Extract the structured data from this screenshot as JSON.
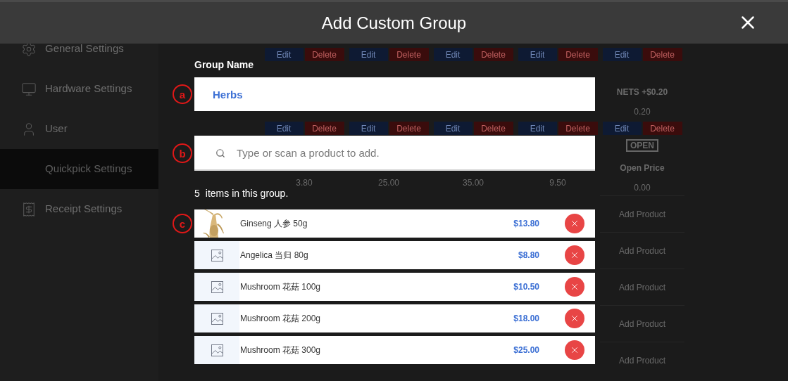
{
  "header": {
    "title": "Add Custom Group"
  },
  "sidebar": {
    "items": [
      {
        "label": "General Settings",
        "selected": false
      },
      {
        "label": "Hardware Settings",
        "selected": false
      },
      {
        "label": "User",
        "selected": false
      },
      {
        "label": "Quickpick Settings",
        "selected": true
      },
      {
        "label": "Receipt Settings",
        "selected": false
      }
    ]
  },
  "tile_rows": [
    {
      "buttons": [
        {
          "edit": "Edit",
          "delete": "Delete"
        },
        {
          "edit": "Edit",
          "delete": "Delete"
        },
        {
          "edit": "Edit",
          "delete": "Delete"
        },
        {
          "edit": "Edit",
          "delete": "Delete"
        },
        {
          "edit": "Edit",
          "delete": "Delete"
        }
      ],
      "side_caption": "NETS +$0.20",
      "side_price": "0.20"
    },
    {
      "buttons": [
        {
          "edit": "Edit",
          "delete": "Delete"
        },
        {
          "edit": "Edit",
          "delete": "Delete"
        },
        {
          "edit": "Edit",
          "delete": "Delete"
        },
        {
          "edit": "Edit",
          "delete": "Delete"
        },
        {
          "edit": "Edit",
          "delete": "Delete"
        }
      ],
      "prices": [
        "3.80",
        "25.00",
        "35.00",
        "9.50"
      ],
      "side_logo": "OPEN",
      "side_caption": "Open Price",
      "side_price": "0.00"
    }
  ],
  "add_product_cells": [
    "Add Product",
    "Add Product",
    "Add Product",
    "Add Product",
    "Add Product"
  ],
  "form": {
    "group_name_label": "Group Name",
    "group_name_value": "Herbs",
    "search_placeholder": "Type or scan a product to add.",
    "count": "5",
    "count_text": "items in this group."
  },
  "annotations": {
    "group_name": "a",
    "search": "b",
    "list": "c"
  },
  "items": [
    {
      "name": "Ginseng 人参 50g",
      "price": "$13.80",
      "kind": "picture"
    },
    {
      "name": "Angelica 当归 80g",
      "price": "$8.80",
      "kind": "placeholder"
    },
    {
      "name": "Mushroom 花菇 100g",
      "price": "$10.50",
      "kind": "placeholder"
    },
    {
      "name": "Mushroom 花菇 200g",
      "price": "$18.00",
      "kind": "placeholder"
    },
    {
      "name": "Mushroom 花菇 300g",
      "price": "$25.00",
      "kind": "placeholder"
    }
  ]
}
